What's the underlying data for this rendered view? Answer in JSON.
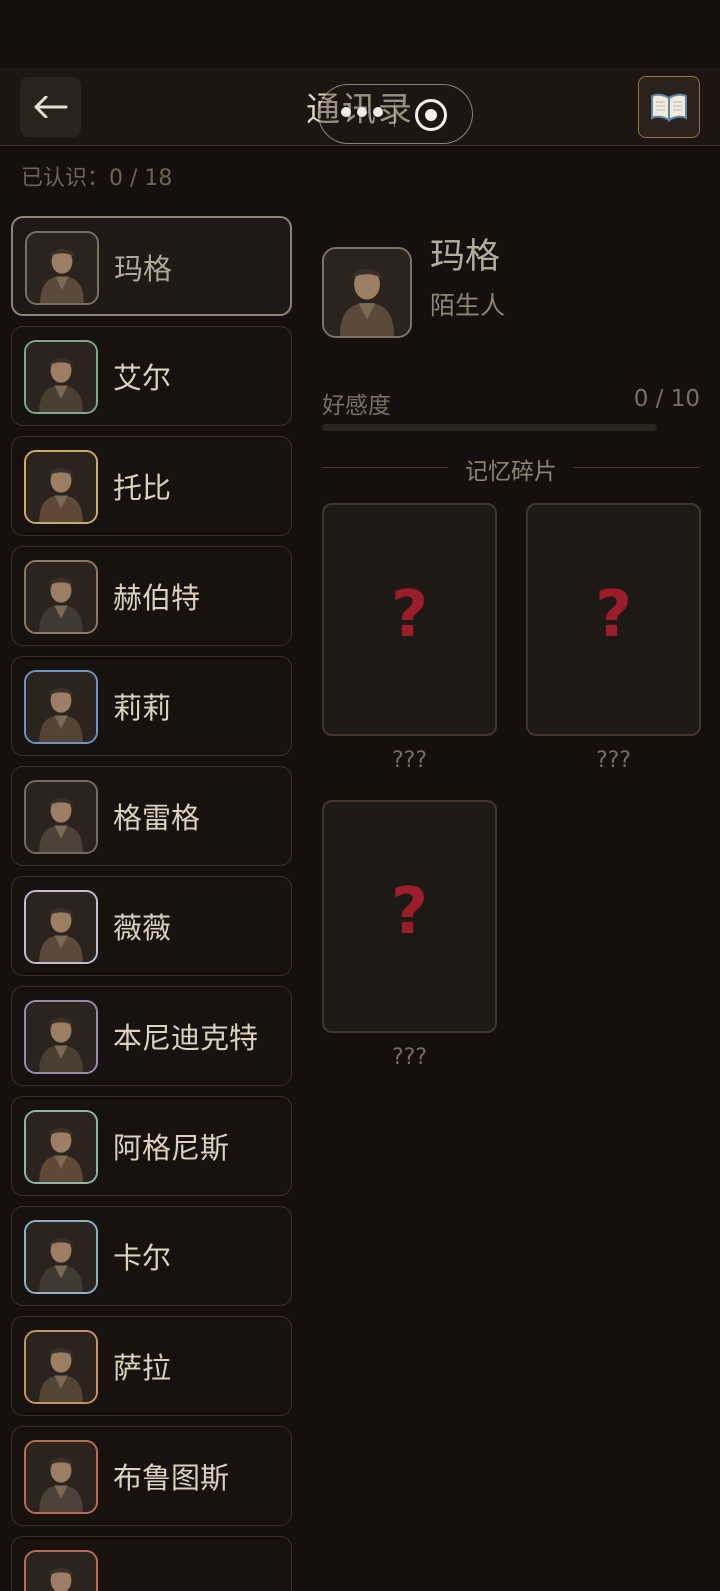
{
  "header": {
    "title": "通讯录",
    "back_icon": "arrow-left-icon",
    "book_icon": "open-book-icon"
  },
  "known_count": "已认识：0 / 18",
  "contacts": [
    {
      "name": "玛格",
      "border": "#7a7062",
      "active": true
    },
    {
      "name": "艾尔",
      "border": "#7ea986",
      "active": false
    },
    {
      "name": "托比",
      "border": "#c9ad6a",
      "active": false
    },
    {
      "name": "赫伯特",
      "border": "#8c7b62",
      "active": false
    },
    {
      "name": "莉莉",
      "border": "#6d93c4",
      "active": false
    },
    {
      "name": "格雷格",
      "border": "#77695b",
      "active": false
    },
    {
      "name": "薇薇",
      "border": "#c4bcd3",
      "active": false
    },
    {
      "name": "本尼迪克特",
      "border": "#9b8ab0",
      "active": false
    },
    {
      "name": "阿格尼斯",
      "border": "#8fb6a5",
      "active": false
    },
    {
      "name": "卡尔",
      "border": "#8bb3c4",
      "active": false
    },
    {
      "name": "萨拉",
      "border": "#c3955f",
      "active": false
    },
    {
      "name": "布鲁图斯",
      "border": "#b96c4f",
      "active": false
    },
    {
      "name": "",
      "border": "#b96c4f",
      "active": false
    }
  ],
  "detail": {
    "name": "玛格",
    "status": "陌生人",
    "affinity_label": "好感度",
    "affinity_value": "0 / 10",
    "affinity_fraction": 0,
    "memory_title": "记忆碎片",
    "memories": [
      {
        "symbol": "?",
        "label": "???"
      },
      {
        "symbol": "?",
        "label": "???"
      },
      {
        "symbol": "?",
        "label": "???"
      }
    ]
  },
  "colors": {
    "accent_gold": "#b39455",
    "question_red": "#9b1c2b"
  }
}
